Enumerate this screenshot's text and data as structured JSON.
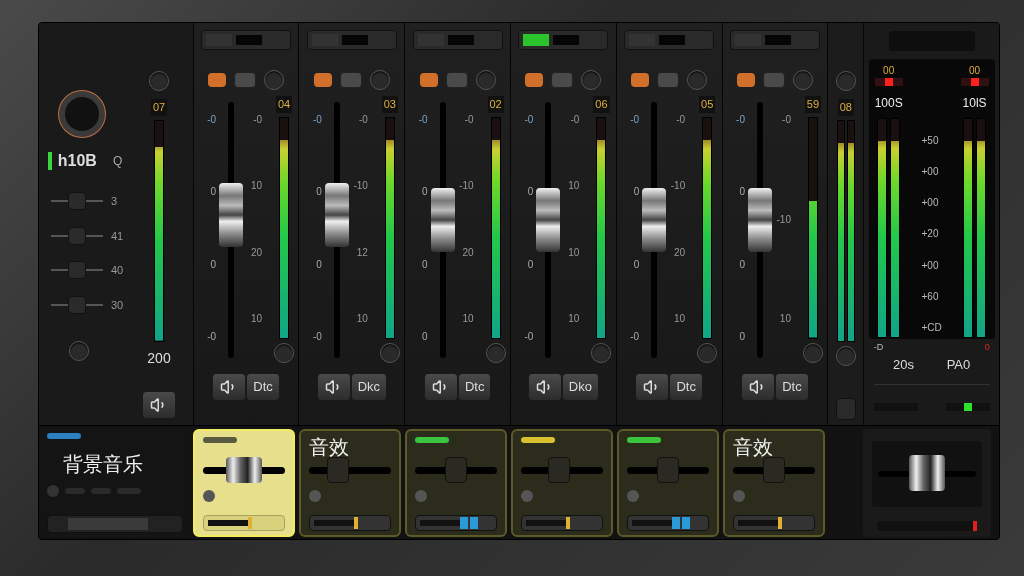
{
  "input_panel": {
    "knob_label": "h10B",
    "knob_side_label": "Q",
    "meter_reading": "07",
    "meter": {
      "level": 0.88
    },
    "lamp_on": true,
    "sends": [
      {
        "label": "3",
        "level": 0.5
      },
      {
        "label": "41",
        "level": 0.5
      },
      {
        "label": "40",
        "level": 0.5
      },
      {
        "label": "30",
        "level": 0.5
      }
    ],
    "bottom_reading": "200"
  },
  "channels": [
    {
      "lamp_on": false,
      "meter_reading": "04",
      "left_scale": [
        "-0",
        "0",
        "0",
        "-0"
      ],
      "right_scale": [
        "-0",
        "10",
        "20",
        "10"
      ],
      "fader": {
        "level": 0.58
      },
      "meter": {
        "level": 0.9
      },
      "button_label": "Dtc"
    },
    {
      "lamp_on": false,
      "meter_reading": "03",
      "left_scale": [
        "-0",
        "0",
        "0",
        "-0"
      ],
      "right_scale": [
        "-0",
        "-10",
        "12",
        "10"
      ],
      "fader": {
        "level": 0.58
      },
      "meter": {
        "level": 0.9
      },
      "button_label": "Dkc"
    },
    {
      "lamp_on": false,
      "meter_reading": "02",
      "left_scale": [
        "-0",
        "0",
        "0",
        "0"
      ],
      "right_scale": [
        "-0",
        "-10",
        "20",
        "10"
      ],
      "fader": {
        "level": 0.55
      },
      "meter": {
        "level": 0.9
      },
      "button_label": "Dtc"
    },
    {
      "lamp_on": true,
      "meter_reading": "06",
      "left_scale": [
        "-0",
        "0",
        "0",
        "-0"
      ],
      "right_scale": [
        "-0",
        "10",
        "10",
        "10"
      ],
      "fader": {
        "level": 0.55
      },
      "meter": {
        "level": 0.9
      },
      "button_label": "Dko"
    },
    {
      "lamp_on": false,
      "meter_reading": "05",
      "left_scale": [
        "-0",
        "0",
        "0",
        "-0"
      ],
      "right_scale": [
        "-0",
        "-10",
        "20",
        "10"
      ],
      "fader": {
        "level": 0.55
      },
      "meter": {
        "level": 0.9
      },
      "button_label": "Dtc"
    },
    {
      "lamp_on": false,
      "meter_reading": "59",
      "left_scale": [
        "-0",
        "0",
        "0",
        "0"
      ],
      "right_scale": [
        "-0",
        "-10",
        "10"
      ],
      "fader": {
        "level": 0.55
      },
      "meter": {
        "level": 0.62
      },
      "button_label": "Dtc"
    }
  ],
  "sub_meter": {
    "meter_reading": "08",
    "meters": [
      {
        "level": 0.9
      },
      {
        "level": 0.9
      }
    ]
  },
  "master": {
    "channels": [
      {
        "peak": "00",
        "label": "100S",
        "meters": [
          {
            "level": 0.9
          },
          {
            "level": 0.9
          }
        ],
        "bottom": "20s"
      },
      {
        "peak": "00",
        "label": "10lS",
        "meters": [
          {
            "level": 0.9
          },
          {
            "level": 0.9
          }
        ],
        "bottom": "PA0"
      }
    ],
    "scale": [
      "+50",
      "+00",
      "+00",
      "+20",
      "+00",
      "+60",
      "+CD"
    ],
    "left_mark": "-D",
    "right_mark": "0"
  },
  "bottom_strip": {
    "title": "背景音乐",
    "cells": [
      {
        "selected": true,
        "color": "#5a5a40",
        "level": 0.5,
        "kind": "single"
      },
      {
        "selected": false,
        "title": "音效",
        "level": 0.3,
        "kind": "single"
      },
      {
        "selected": false,
        "color": "#3cc43c",
        "level": 0.5,
        "kind": "double"
      },
      {
        "selected": false,
        "color": "#d8c030",
        "level": 0.45,
        "kind": "single"
      },
      {
        "selected": false,
        "color": "#3cc43c",
        "level": 0.5,
        "kind": "double"
      },
      {
        "selected": false,
        "title": "音效",
        "level": 0.5,
        "kind": "single"
      }
    ],
    "master_cell": {
      "level": 0.5
    }
  }
}
